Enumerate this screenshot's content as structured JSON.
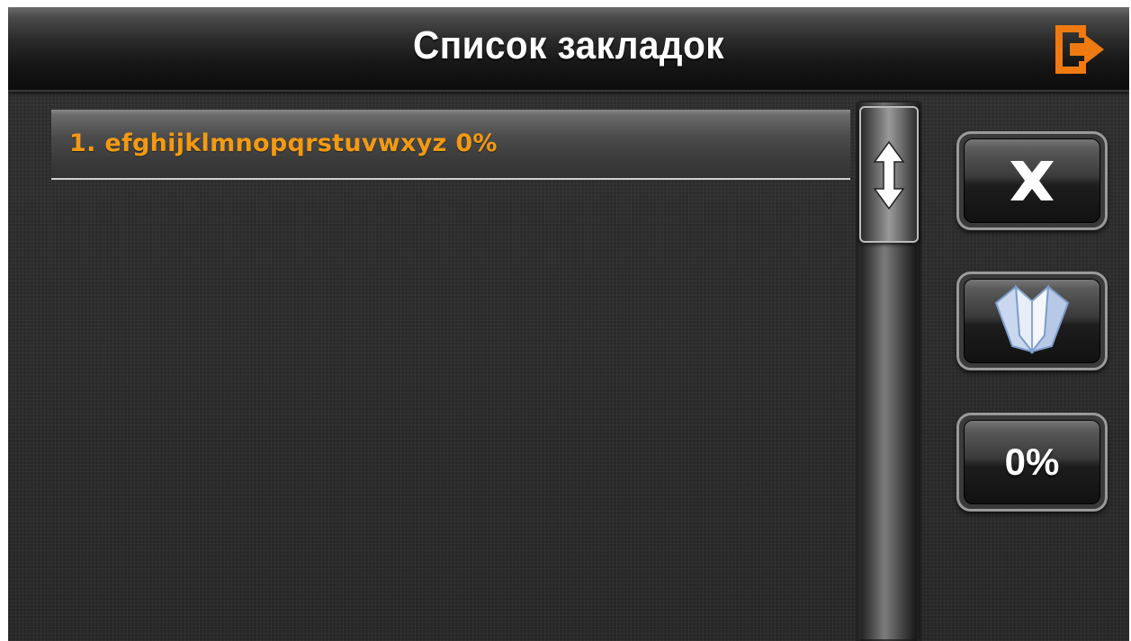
{
  "header": {
    "title": "Список закладок",
    "exit_icon": "exit-door-icon",
    "accent_color": "#f07a12"
  },
  "bookmarks": {
    "items": [
      {
        "label": "1. efghijklmnopqrstuvwxyz 0%"
      }
    ],
    "item_text_color": "#f39a12"
  },
  "scrollbar": {
    "thumb_icon": "up-down-arrow-icon"
  },
  "actions": {
    "delete_icon": "close-x-icon",
    "open_icon": "open-book-icon",
    "percent_label": "0%"
  }
}
